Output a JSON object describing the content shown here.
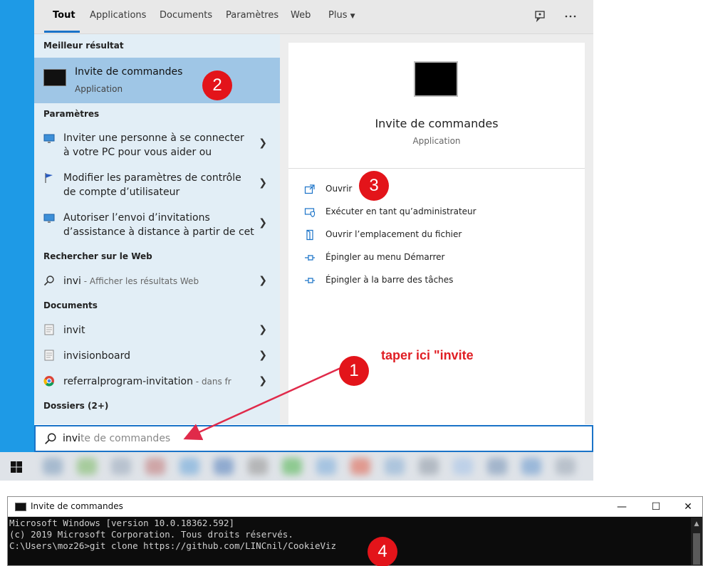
{
  "tabs": [
    {
      "label": "Tout",
      "active": true
    },
    {
      "label": "Applications"
    },
    {
      "label": "Documents"
    },
    {
      "label": "Paramètres"
    },
    {
      "label": "Web"
    },
    {
      "label": "Plus"
    }
  ],
  "left": {
    "best_heading": "Meilleur résultat",
    "best": {
      "title": "Invite de commandes",
      "subtitle": "Application"
    },
    "settings_heading": "Paramètres",
    "settings": [
      {
        "line1": "Inviter une personne à se connecter",
        "line2": "à votre PC pour vous aider ou",
        "icon": "monitor-icon"
      },
      {
        "line1": "Modifier les paramètres de contrôle",
        "line2": "de compte d’utilisateur",
        "icon": "flag-icon"
      },
      {
        "line1": "Autoriser l’envoi d’invitations",
        "line2": "d’assistance à distance à partir de cet",
        "icon": "monitor-icon"
      }
    ],
    "web_heading": "Rechercher sur le Web",
    "web": {
      "query": "invi",
      "suffix": " - Afficher les résultats Web"
    },
    "docs_heading": "Documents",
    "docs": [
      {
        "label": "invit",
        "suffix": ""
      },
      {
        "label": "invisionboard",
        "suffix": ""
      },
      {
        "label": "referralprogram-invitation",
        "suffix": " - dans fr"
      }
    ],
    "folders_heading": "Dossiers (2+)"
  },
  "right": {
    "title": "Invite de commandes",
    "subtitle": "Application",
    "actions": [
      {
        "label": "Ouvrir",
        "icon": "open-icon"
      },
      {
        "label": "Exécuter en tant qu’administrateur",
        "icon": "shield-icon"
      },
      {
        "label": "Ouvrir l’emplacement du fichier",
        "icon": "folder-location-icon"
      },
      {
        "label": "Épingler au menu Démarrer",
        "icon": "pin-icon"
      },
      {
        "label": "Épingler à la barre des tâches",
        "icon": "pin-icon"
      }
    ]
  },
  "search": {
    "typed": "invi",
    "rest": "te de commandes"
  },
  "annotations": {
    "text": "taper ici \"invite",
    "b1": "1",
    "b2": "2",
    "b3": "3",
    "b4": "4",
    "color": "#e3141a"
  },
  "cmd": {
    "title": "Invite de commandes",
    "lines": [
      "Microsoft Windows [version 10.0.18362.592]",
      "(c) 2019 Microsoft Corporation. Tous droits réservés.",
      "",
      "C:\\Users\\moz26>git clone https://github.com/LINCnil/CookieViz"
    ],
    "minimize": "—",
    "maximize": "☐",
    "close": "✕"
  },
  "colors": {
    "accent": "#1a73c8",
    "highlight": "#9fc6e6",
    "desktop": "#1e9ae6"
  }
}
